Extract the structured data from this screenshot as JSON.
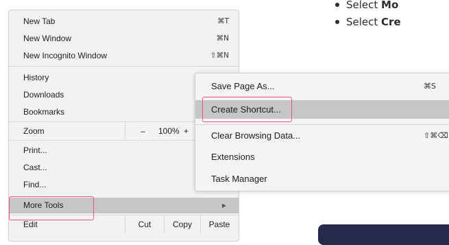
{
  "menu": {
    "new_tab": {
      "label": "New Tab",
      "shortcut": "⌘T"
    },
    "new_window": {
      "label": "New Window",
      "shortcut": "⌘N"
    },
    "new_incognito": {
      "label": "New Incognito Window",
      "shortcut": "⇧⌘N"
    },
    "history": "History",
    "downloads": "Downloads",
    "bookmarks": "Bookmarks",
    "zoom": {
      "label": "Zoom",
      "minus": "–",
      "value": "100%",
      "plus": "+"
    },
    "print": "Print...",
    "cast": "Cast...",
    "find": "Find...",
    "more_tools": {
      "label": "More Tools",
      "arrow": "▶"
    },
    "edit": {
      "label": "Edit",
      "cut": "Cut",
      "copy": "Copy",
      "paste": "Paste"
    }
  },
  "submenu": {
    "save_page": {
      "label": "Save Page As...",
      "shortcut": "⌘S"
    },
    "create_shortcut": "Create Shortcut...",
    "clear_browsing": {
      "label": "Clear Browsing Data...",
      "shortcut": "⇧⌘⌫"
    },
    "extensions": "Extensions",
    "task_manager": "Task Manager"
  },
  "instructions": [
    {
      "prefix": "Select ",
      "bold": "Mo"
    },
    {
      "prefix": "Select ",
      "bold": "Cre"
    }
  ],
  "colors": {
    "highlight": "#e8528d",
    "menu_bg": "#f2f2f2",
    "selected_row": "#c6c6c6",
    "cta": "#242a4a"
  }
}
